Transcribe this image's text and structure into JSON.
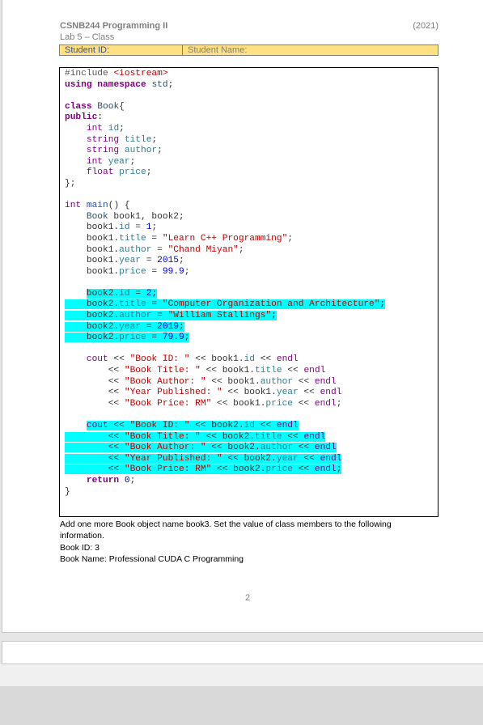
{
  "header": {
    "course": "CSNB244 Programming II",
    "year": "(2021)",
    "lab": "Lab 5 – Class",
    "student_id_label": "Student ID:",
    "student_name_label": "Student Name:"
  },
  "code": {
    "language": "cpp",
    "lines": [
      "#include <iostream>",
      "using namespace std;",
      "",
      "class Book{",
      "public:",
      "    int id;",
      "    string title;",
      "    string author;",
      "    int year;",
      "    float price;",
      "};",
      "",
      "int main() {",
      "    Book book1, book2;",
      "    book1.id = 1;",
      "    book1.title = \"Learn C++ Programming\";",
      "    book1.author = \"Chand Miyan\";",
      "    book1.year = 2015;",
      "    book1.price = 99.9;",
      "",
      "    book2.id = 2;",
      "    book2.title = \"Computer Organization and Architecture\";",
      "    book2.author = \"William Stallings\";",
      "    book2.year = 2019;",
      "    book2.price = 79.9;",
      "",
      "    cout << \"Book ID: \" << book1.id << endl",
      "        << \"Book Title: \" << book1.title << endl",
      "        << \"Book Author: \" << book1.author << endl",
      "        << \"Year Published: \" << book1.year << endl",
      "        << \"Book Price: RM\" << book1.price << endl;",
      "",
      "    cout << \"Book ID: \" << book2.id << endl",
      "        << \"Book Title: \" << book2.title << endl",
      "        << \"Book Author: \" << book2.author << endl",
      "        << \"Year Published: \" << book2.year << endl",
      "        << \"Book Price: RM\" << book2.price << endl;",
      "    return 0;",
      "}"
    ],
    "highlight_color": "#00ffff",
    "highlighted_lines": [
      20,
      21,
      22,
      23,
      24,
      32,
      33,
      34,
      35,
      36
    ]
  },
  "instructions": {
    "line1": "Add one more Book object name book3. Set the value of class members to the following information.",
    "line2": "Book ID: 3",
    "line3": "Book Name: Professional CUDA C Programming"
  },
  "footer": {
    "page_number": "2"
  },
  "colors": {
    "header_bar": "#ffe083",
    "header_text": "#7f7f7f",
    "highlight": "#00ffff"
  }
}
